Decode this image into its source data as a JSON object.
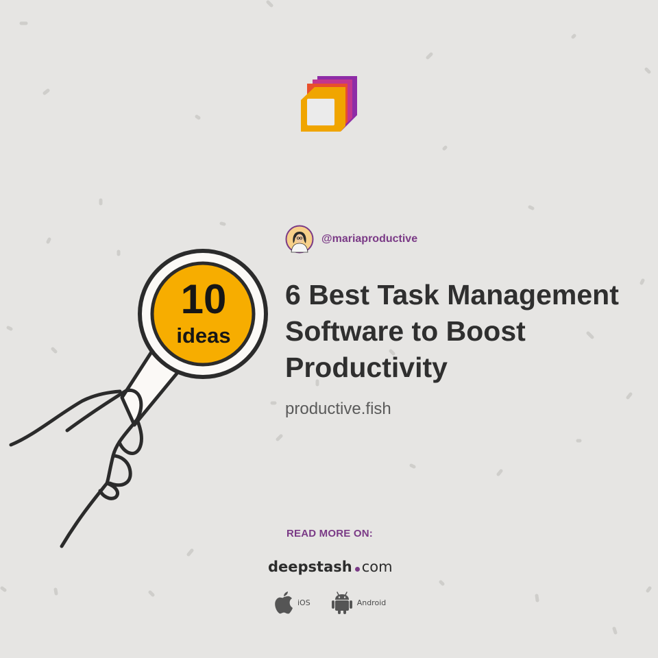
{
  "badge": {
    "number": "10",
    "label": "ideas"
  },
  "author": {
    "handle": "@mariaproductive"
  },
  "article": {
    "title": "6 Best Task Management Software to Boost Productivity",
    "source": "productive.fish"
  },
  "footer": {
    "read_more": "READ MORE ON:",
    "brand_name": "deepstash",
    "brand_tld": "com",
    "stores": [
      {
        "label": "iOS",
        "icon": "apple-icon"
      },
      {
        "label": "Android",
        "icon": "android-icon"
      }
    ]
  },
  "colors": {
    "background": "#e6e5e3",
    "accent_purple": "#7a3a86",
    "badge_yellow": "#f7ad00",
    "logo_orange": "#f0a500",
    "logo_red": "#e8502c",
    "logo_purple": "#8e2ca6"
  }
}
